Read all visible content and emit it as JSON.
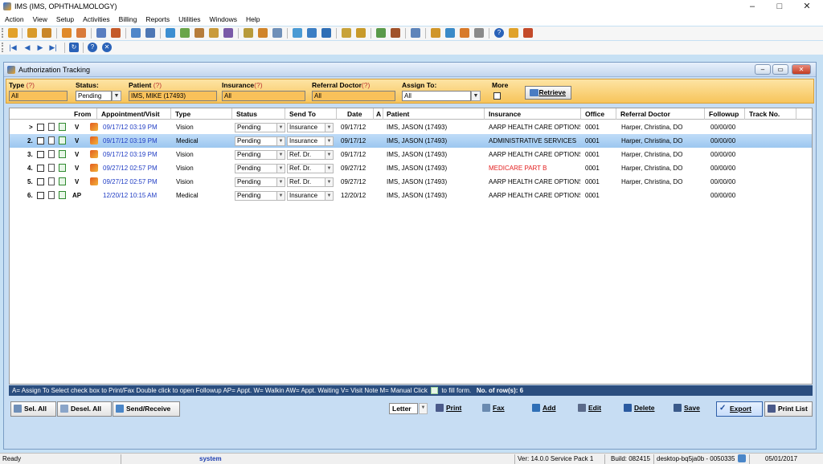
{
  "app": {
    "title": "IMS (IMS, OPHTHALMOLOGY)",
    "controls": [
      "–",
      "□",
      "✕"
    ]
  },
  "menu": [
    "Action",
    "View",
    "Setup",
    "Activities",
    "Billing",
    "Reports",
    "Utilities",
    "Windows",
    "Help"
  ],
  "child_window": {
    "title": "Authorization Tracking"
  },
  "filters": {
    "type": {
      "label": "Type",
      "help": "(?)",
      "value": "All"
    },
    "status": {
      "label": "Status:",
      "value": "Pending"
    },
    "patient": {
      "label": "Patient",
      "help": "(?)",
      "value": "IMS, MIKE  (17493)"
    },
    "insurance": {
      "label": "Insurance",
      "help": "(?)",
      "value": "All"
    },
    "referral_doctor": {
      "label": "Referral Doctor",
      "help": "(?)",
      "value": "All"
    },
    "assign_to": {
      "label": "Assign To:",
      "value": "All"
    },
    "more": {
      "label": "More"
    },
    "retrieve_label": "Retrieve"
  },
  "grid": {
    "columns": [
      "From",
      "Appointment/Visit",
      "Type",
      "Status",
      "Send To",
      "Date",
      "A",
      "Patient",
      "Insurance",
      "Office",
      "Referral Doctor",
      "Followup",
      "Track No."
    ],
    "rows": [
      {
        "num": ">",
        "from": "V",
        "appt": "09/17/12 03:19 PM",
        "type": "Vision",
        "status": "Pending",
        "send_to": "Insurance",
        "date": "09/17/12",
        "patient": "IMS, JASON  (17493)",
        "insurance": "AARP HEALTH CARE OPTIONS",
        "office": "0001",
        "referral_doctor": "Harper, Christina, DO",
        "followup": "00/00/00",
        "selected": false,
        "ins_red": false
      },
      {
        "num": "2.",
        "from": "V",
        "appt": "09/17/12 03:19 PM",
        "type": "Medical",
        "status": "Pending",
        "send_to": "Insurance",
        "date": "09/17/12",
        "patient": "IMS, JASON  (17493)",
        "insurance": "ADMINISTRATIVE SERVICES",
        "office": "0001",
        "referral_doctor": "Harper, Christina, DO",
        "followup": "00/00/00",
        "selected": true,
        "ins_red": false
      },
      {
        "num": "3.",
        "from": "V",
        "appt": "09/17/12 03:19 PM",
        "type": "Vision",
        "status": "Pending",
        "send_to": "Ref. Dr.",
        "date": "09/17/12",
        "patient": "IMS, JASON  (17493)",
        "insurance": "AARP HEALTH CARE OPTIONS",
        "office": "0001",
        "referral_doctor": "Harper, Christina, DO",
        "followup": "00/00/00",
        "selected": false,
        "ins_red": false
      },
      {
        "num": "4.",
        "from": "V",
        "appt": "09/27/12 02:57 PM",
        "type": "Vision",
        "status": "Pending",
        "send_to": "Ref. Dr.",
        "date": "09/27/12",
        "patient": "IMS, JASON  (17493)",
        "insurance": "MEDICARE PART B",
        "office": "0001",
        "referral_doctor": "Harper, Christina, DO",
        "followup": "00/00/00",
        "selected": false,
        "ins_red": true
      },
      {
        "num": "5.",
        "from": "V",
        "appt": "09/27/12 02:57 PM",
        "type": "Vision",
        "status": "Pending",
        "send_to": "Ref. Dr.",
        "date": "09/27/12",
        "patient": "IMS, JASON  (17493)",
        "insurance": "AARP HEALTH CARE OPTIONS",
        "office": "0001",
        "referral_doctor": "Harper, Christina, DO",
        "followup": "00/00/00",
        "selected": false,
        "ins_red": false
      },
      {
        "num": "6.",
        "from": "AP",
        "appt": "12/20/12 10:15 AM",
        "type": "Medical",
        "status": "Pending",
        "send_to": "Insurance",
        "date": "12/20/12",
        "patient": "IMS, JASON  (17493)",
        "insurance": "AARP HEALTH CARE OPTIONS",
        "office": "0001",
        "referral_doctor": "",
        "followup": "00/00/00",
        "selected": false,
        "ins_red": false
      }
    ]
  },
  "legend": {
    "text": "A= Assign To   Select check box to Print/Fax    Double click to open Followup    AP= Appt. W= Walkin  AW= Appt. Waiting  V= Visit Note  M= Manual    Click",
    "fill_text": "to fill form.",
    "rows_label": "No. of row(s): 6"
  },
  "buttons": {
    "sel_all": "Sel. All",
    "desel_all": "Desel. All",
    "send_receive": "Send/Receive",
    "letter": "Letter",
    "print": "Print",
    "fax": "Fax",
    "add": "Add",
    "edit": "Edit",
    "delete": "Delete",
    "save": "Save",
    "export": "Export",
    "print_list": "Print List"
  },
  "statusbar": {
    "ready": "Ready",
    "user": "system",
    "version": "Ver: 14.0.0 Service Pack 1",
    "build": "Build: 082415",
    "machine": "desktop-bq5ja0b - 0050335",
    "date": "05/01/2017"
  }
}
